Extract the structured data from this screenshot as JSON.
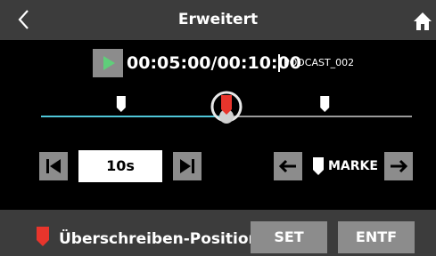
{
  "header": {
    "title": "Erweitert",
    "back_icon": "chevron-left-icon",
    "home_icon": "home-icon"
  },
  "transport": {
    "play_icon": "play-icon",
    "position_time": "00:05:00/00:10:00",
    "project_name": "PODCAST_002"
  },
  "timeline": {
    "progress": 0.5,
    "played_color": "#4fc6d8",
    "unplayed_color": "#9a9a9a",
    "mark_positions": [
      0.216,
      0.765
    ],
    "overwrite_position": 0.5
  },
  "controls": {
    "skip_back_icon": "skip-to-start-icon",
    "skip_value": "10s",
    "skip_forward_icon": "skip-to-end-icon",
    "prev_marker_icon": "arrow-left-icon",
    "marker_icon": "marker-icon",
    "marker_label": "MARKE",
    "next_marker_icon": "arrow-right-icon"
  },
  "footer": {
    "overwrite_icon": "overwrite-marker-icon",
    "overwrite_label": "Überschreiben-Position",
    "set_label": "SET",
    "delete_label": "ENTF",
    "accent_color": "#e8352c"
  }
}
